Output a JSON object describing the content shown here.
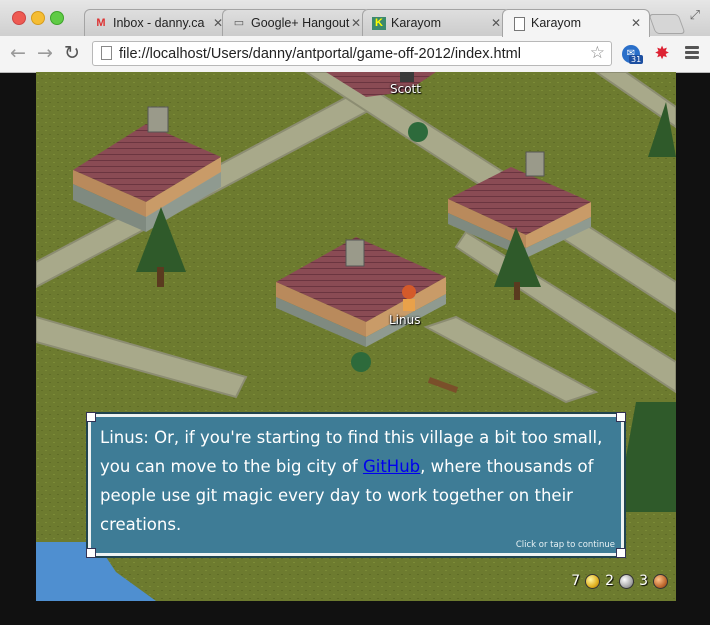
{
  "browser": {
    "tabs": [
      {
        "label": "Inbox - danny.ca",
        "icon": "gmail-icon",
        "active": false
      },
      {
        "label": "Google+ Hangout",
        "icon": "hangouts-icon",
        "active": false
      },
      {
        "label": "Karayom",
        "icon": "karayom-icon",
        "active": false
      },
      {
        "label": "Karayom",
        "icon": "page-icon",
        "active": true
      }
    ],
    "url": "file://localhost/Users/danny/antportal/game-off-2012/index.html",
    "extension_badge": "31"
  },
  "game": {
    "characters": [
      {
        "name": "Scott"
      },
      {
        "name": "Linus"
      }
    ],
    "dialog": {
      "text_before": "Linus: Or, if you're starting to find this village a bit too small, you can move to the big city of ",
      "link_text": "GitHub",
      "text_after": ", where thousands of people use git magic every day to work together on their creations.",
      "hint": "Click or tap to continue"
    },
    "hud": {
      "gold": "7",
      "silver": "2",
      "copper": "3"
    }
  }
}
